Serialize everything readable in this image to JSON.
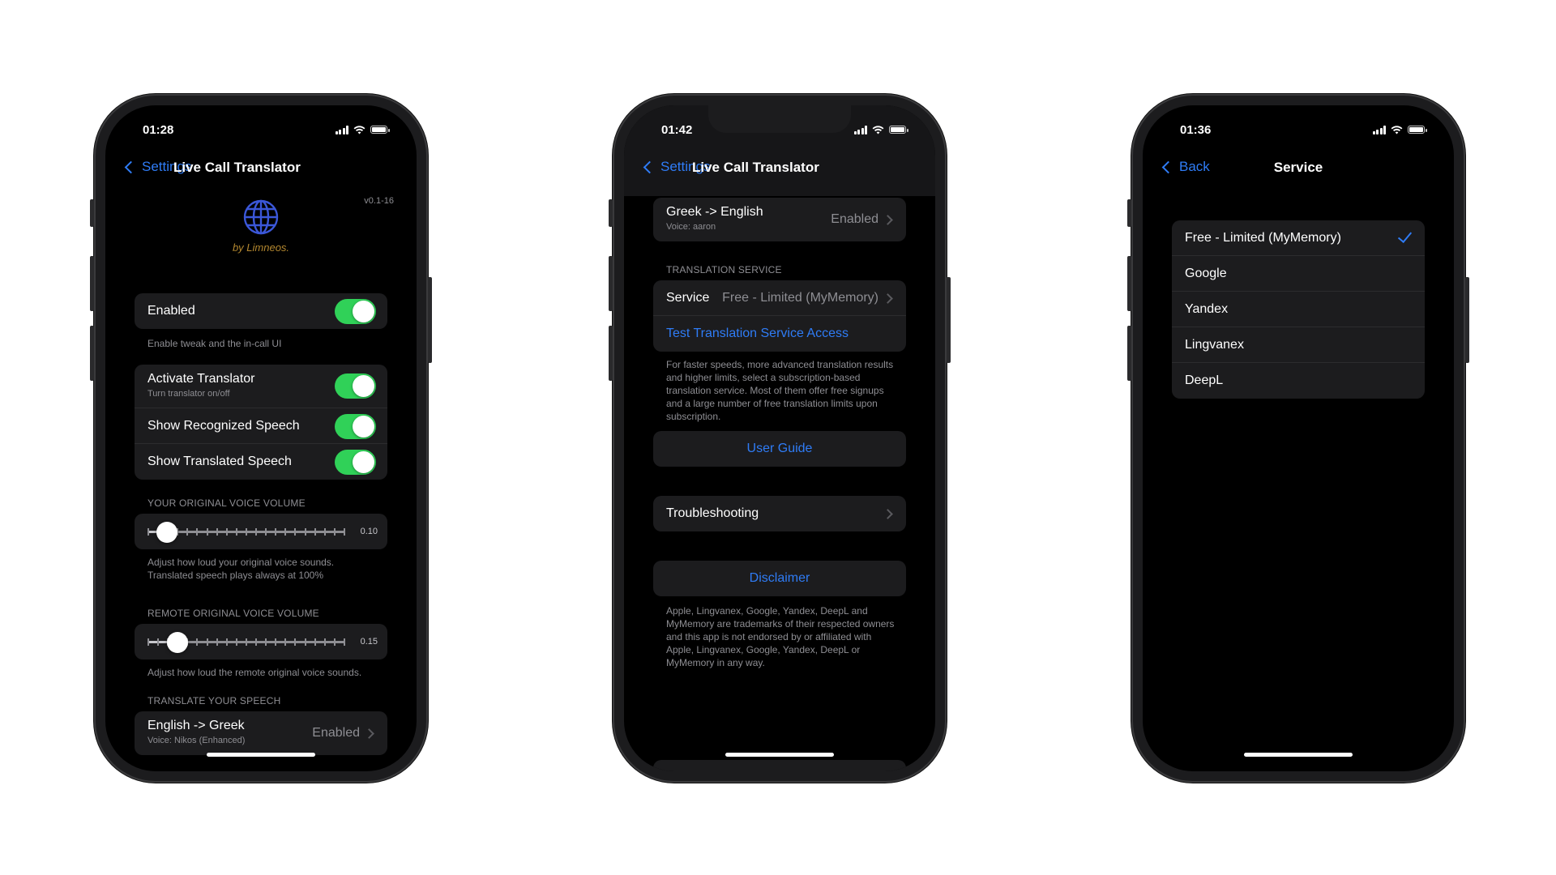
{
  "phones": [
    {
      "time": "01:28",
      "nav": {
        "back_label": "Settings",
        "title": "Live Call Translator"
      },
      "version": "v0.1-16",
      "byline": "by Limneos.",
      "enabled": {
        "label": "Enabled",
        "on": true,
        "footer": "Enable tweak and the in-call UI"
      },
      "toggles": [
        {
          "label": "Activate Translator",
          "sublabel": "Turn translator on/off",
          "on": true
        },
        {
          "label": "Show Recognized Speech",
          "on": true
        },
        {
          "label": "Show Translated Speech",
          "on": true
        }
      ],
      "original_volume": {
        "header": "YOUR ORIGINAL VOICE VOLUME",
        "value": 0.1,
        "value_label": "0.10",
        "footer": "Adjust how loud your original voice sounds. Translated speech plays always at 100%"
      },
      "remote_volume": {
        "header": "REMOTE ORIGINAL VOICE VOLUME",
        "value": 0.15,
        "value_label": "0.15",
        "footer": "Adjust how loud the remote original voice sounds."
      },
      "translate": {
        "header": "TRANSLATE YOUR SPEECH",
        "label": "English -> Greek",
        "sublabel": "Voice: Nikos (Enhanced)",
        "value": "Enabled"
      }
    },
    {
      "time": "01:42",
      "nav": {
        "back_label": "Settings",
        "title": "Live Call Translator"
      },
      "language_row": {
        "label": "Greek -> English",
        "sublabel": "Voice: aaron",
        "value": "Enabled"
      },
      "service_section": {
        "header": "TRANSLATION SERVICE",
        "service_label": "Service",
        "service_value": "Free - Limited (MyMemory)",
        "test_label": "Test Translation Service Access",
        "footer": "For faster speeds, more advanced translation results and higher limits, select a subscription-based translation service. Most of them offer free signups and a large number of free translation limits upon subscription."
      },
      "user_guide": "User Guide",
      "troubleshooting": "Troubleshooting",
      "disclaimer": {
        "label": "Disclaimer",
        "footer": "Apple, Lingvanex, Google, Yandex, DeepL and MyMemory are trademarks of their respected owners and this app is not endorsed by or affiliated with Apple, Lingvanex, Google, Yandex, DeepL or MyMemory in any way."
      }
    },
    {
      "time": "01:36",
      "nav": {
        "back_label": "Back",
        "title": "Service"
      },
      "options": [
        {
          "label": "Free - Limited (MyMemory)",
          "selected": true
        },
        {
          "label": "Google",
          "selected": false
        },
        {
          "label": "Yandex",
          "selected": false
        },
        {
          "label": "Lingvanex",
          "selected": false
        },
        {
          "label": "DeepL",
          "selected": false
        }
      ]
    }
  ],
  "colors": {
    "accent": "#2f7cf6",
    "toggle_on": "#30d158",
    "background": "#000000",
    "cell": "#1c1c1e",
    "secondary_text": "#8e8e93",
    "byline": "#b3872f"
  },
  "icons": [
    "chevron-left-icon",
    "chevron-right-icon",
    "globe-icon",
    "checkmark-icon",
    "signal-icon",
    "wifi-icon",
    "battery-icon"
  ]
}
